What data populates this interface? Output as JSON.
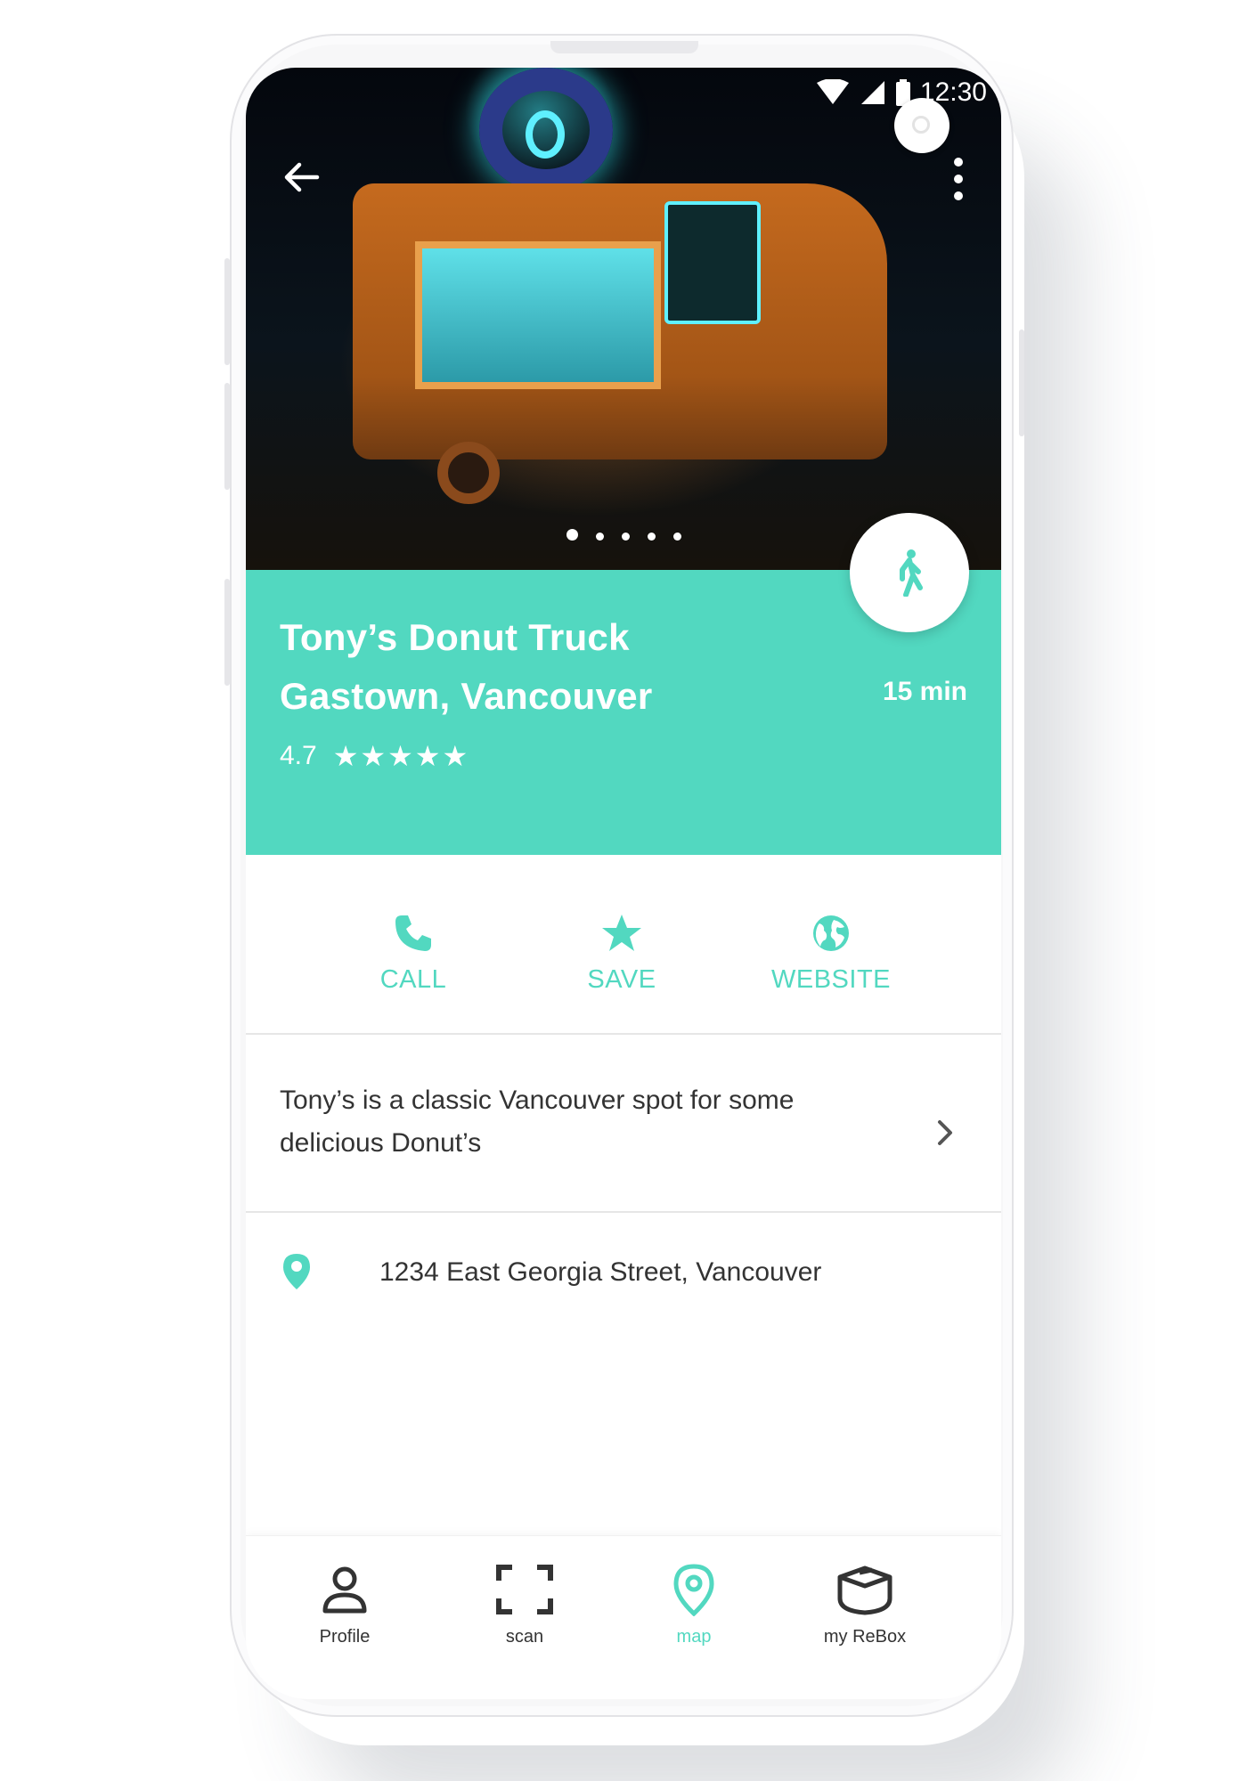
{
  "status_bar": {
    "time": "12:30"
  },
  "place": {
    "name": "Tony’s Donut Truck",
    "area": "Gastown, Vancouver",
    "rating": "4.7",
    "stars": "★★★★★",
    "eta": "15 min"
  },
  "carousel": {
    "count": 5,
    "active_index": 0
  },
  "actions": {
    "call": "CALL",
    "save": "SAVE",
    "website": "WEBSITE"
  },
  "description": "Tony’s is a classic Vancouver spot for some delicious Donut’s",
  "address": "1234 East Georgia Street, Vancouver",
  "nav": {
    "profile": "Profile",
    "scan": "scan",
    "map": "map",
    "rebox": "my ReBox",
    "active": "map"
  },
  "colors": {
    "accent": "#52d8c0",
    "text": "#333333"
  }
}
